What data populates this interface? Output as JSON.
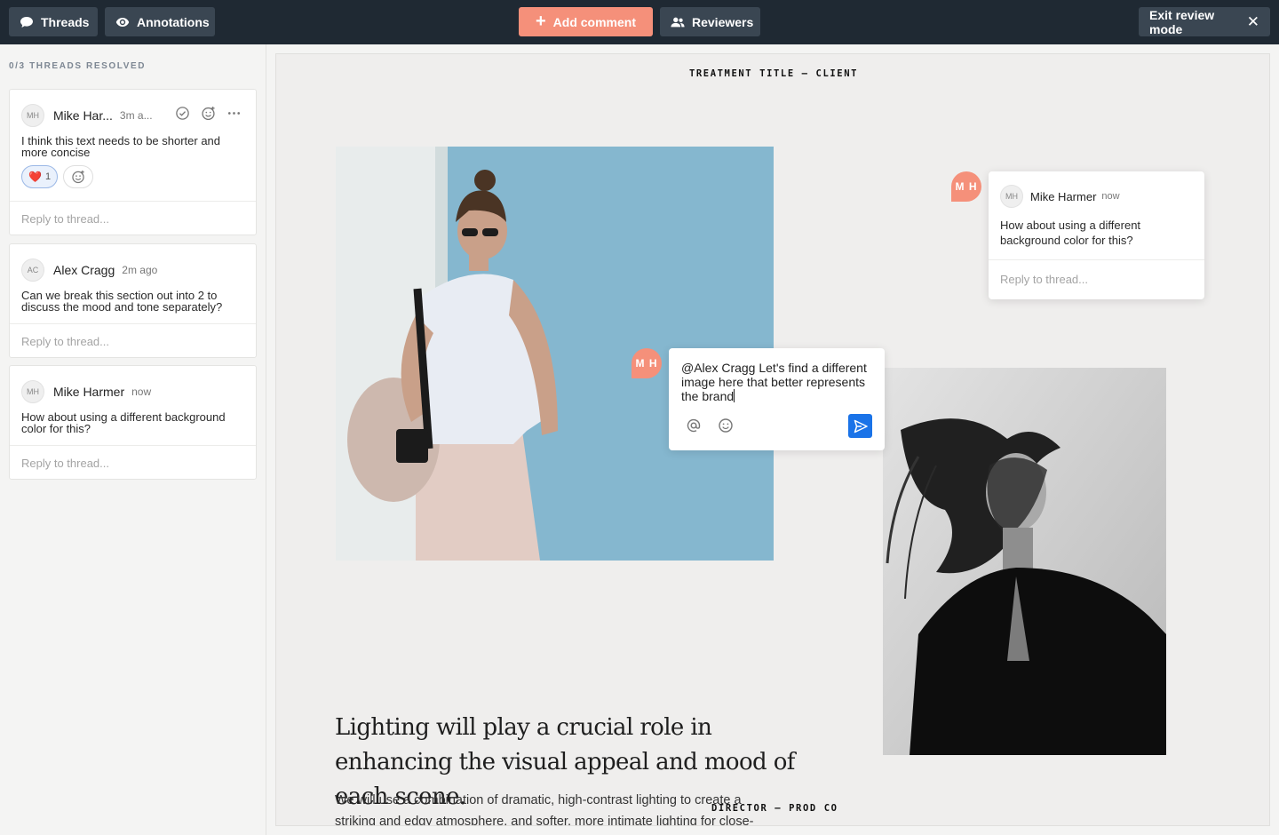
{
  "toolbar": {
    "threads_label": "Threads",
    "annotations_label": "Annotations",
    "add_comment_label": "Add comment",
    "reviewers_label": "Reviewers",
    "exit_label": "Exit review mode"
  },
  "sidebar": {
    "resolved_status": "0/3 THREADS RESOLVED",
    "threads": [
      {
        "initials": "MH",
        "author": "Mike Har...",
        "time": "3m a...",
        "text": "I think this text needs to be shorter and more concise",
        "reaction_emoji": "❤️",
        "reaction_count": "1",
        "reply_placeholder": "Reply to thread..."
      },
      {
        "initials": "AC",
        "author": "Alex Cragg",
        "time": "2m ago",
        "text": "Can we break this section out into 2 to discuss the mood and tone separately?",
        "reply_placeholder": "Reply to thread..."
      },
      {
        "initials": "MH",
        "author": "Mike Harmer",
        "time": "now",
        "text": "How about using a different background color for this?",
        "reply_placeholder": "Reply to thread..."
      }
    ]
  },
  "canvas": {
    "treatment_title": "TREATMENT TITLE — CLIENT",
    "director": "DIRECTOR — PROD CO",
    "headline": "Lighting will play a crucial role in enhancing the visual appeal and mood of each scene.",
    "body": "We will use a combination of dramatic, high-contrast lighting to create a striking and edgy atmosphere, and softer, more intimate lighting for close-"
  },
  "annotations": {
    "pin_initials": "M H",
    "popover": {
      "initials": "MH",
      "author": "Mike Harmer",
      "time": "now",
      "text": "How about using a different background color for this?",
      "reply_placeholder": "Reply to thread..."
    },
    "composer": {
      "text": "@Alex Cragg Let's find a different image here that better represents the brand"
    }
  },
  "colors": {
    "topbar": "#1f2933",
    "accent": "#f5907a",
    "send": "#1a73e8"
  },
  "icons": [
    "chat-icon",
    "eye-icon",
    "plus-icon",
    "users-icon",
    "close-icon",
    "check-circle-icon",
    "add-reaction-icon",
    "more-icon",
    "at-icon",
    "emoji-icon",
    "send-icon"
  ]
}
